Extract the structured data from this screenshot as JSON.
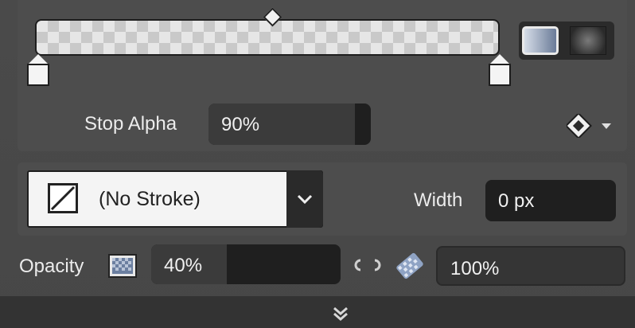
{
  "gradient": {
    "stop_alpha_label": "Stop Alpha",
    "stop_alpha_value": "90%",
    "stop_alpha_fraction": 0.9,
    "modes": [
      "linear-gradient-icon",
      "radial-gradient-icon"
    ],
    "selected_mode": "linear"
  },
  "stroke": {
    "selected": "(No Stroke)",
    "width_label": "Width",
    "width_value": "0 px"
  },
  "opacity": {
    "label": "Opacity",
    "value": "40%",
    "fraction": 0.4,
    "fill_value": "100%"
  },
  "colors": {
    "panel": "#4a4a4a",
    "field": "#1f1f1f",
    "text": "#ececec"
  }
}
